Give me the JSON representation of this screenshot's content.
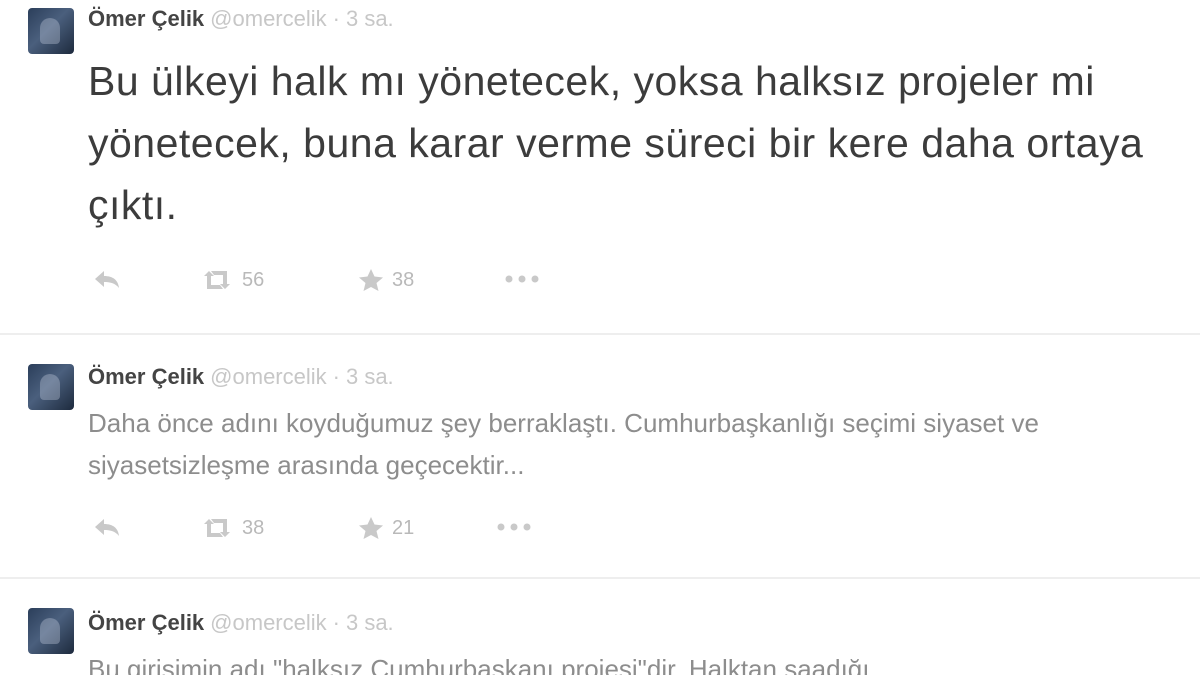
{
  "tweets": [
    {
      "name": "Ömer Çelik",
      "handle": "@omercelik",
      "dot": "·",
      "time": "3 sa.",
      "text": "Bu ülkeyi halk mı yönetecek, yoksa halksız projeler mi yönetecek, buna karar verme süreci bir kere daha ortaya çıktı.",
      "retweets": "56",
      "favorites": "38"
    },
    {
      "name": "Ömer Çelik",
      "handle": "@omercelik",
      "dot": "·",
      "time": "3 sa.",
      "text": "Daha önce adını koyduğumuz şey berraklaştı. Cumhurbaşkanlığı seçimi siyaset ve siyasetsizleşme arasında geçecektir...",
      "retweets": "38",
      "favorites": "21"
    },
    {
      "name": "Ömer Çelik",
      "handle": "@omercelik",
      "dot": "·",
      "time": "3 sa.",
      "text": "Bu girişimin adı \"halksız Cumhurbaşkanı projesi\"dir. Halktan saadığı"
    }
  ],
  "icons": {
    "reply": "reply-icon",
    "retweet": "retweet-icon",
    "favorite": "star-icon",
    "more": "more-icon"
  },
  "colors": {
    "name": "#444444",
    "meta": "#c7c7c7",
    "body_large": "#3c3c3c",
    "body_small": "#8d8d8d",
    "icons": "#c4c4c4"
  }
}
